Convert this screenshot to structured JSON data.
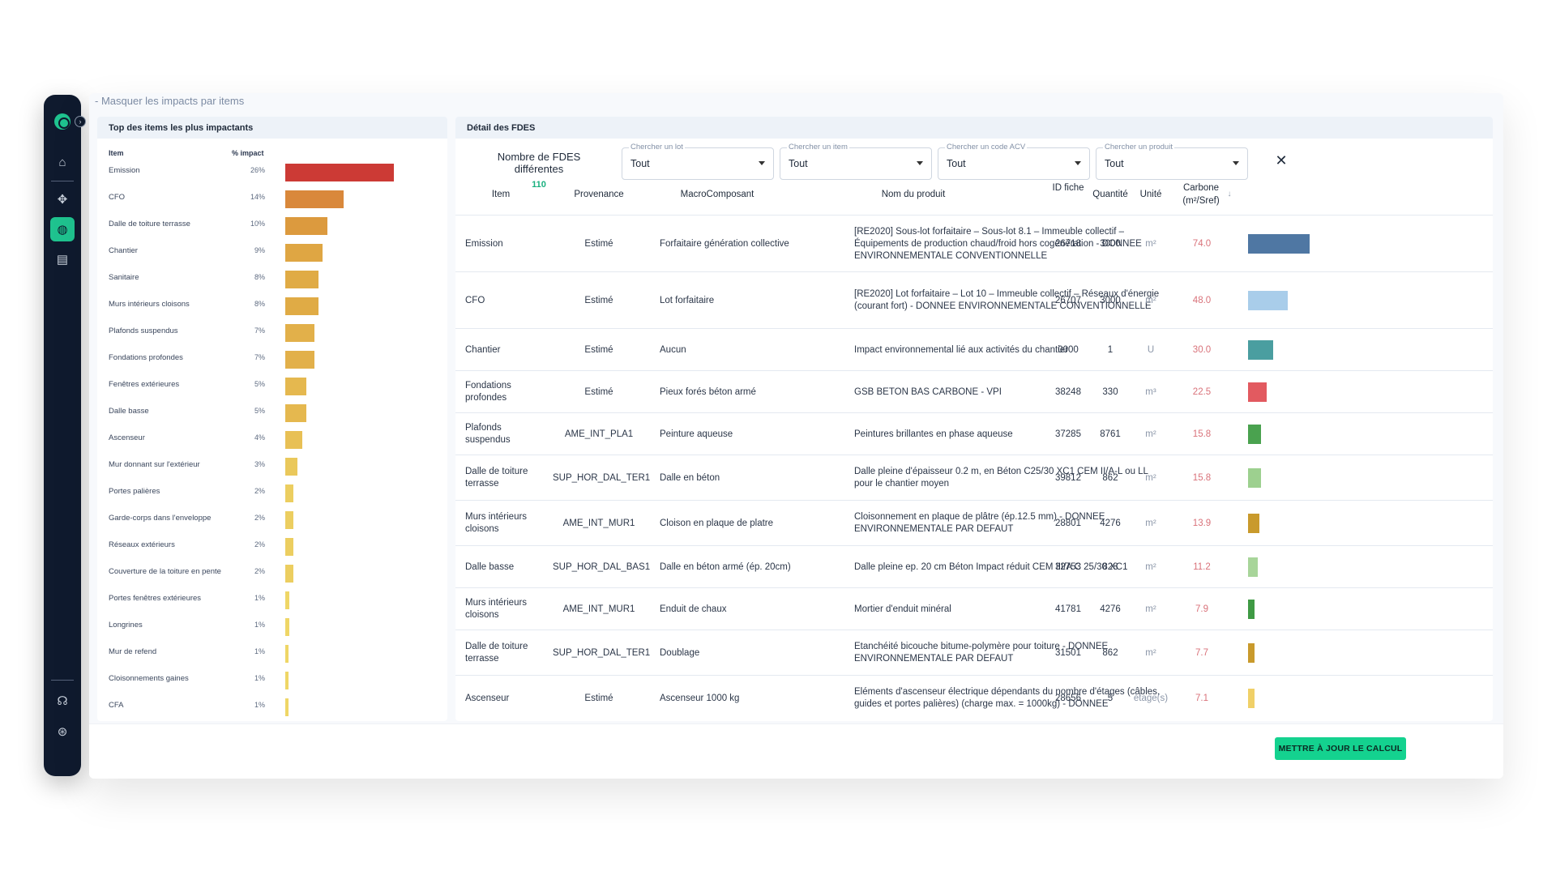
{
  "toggle_link": "- Masquer les impacts par items",
  "left_panel": {
    "title": "Top des items les plus impactants",
    "col_item": "Item",
    "col_pct": "% impact",
    "rows": [
      {
        "name": "Emission",
        "pct": "26%",
        "value": 26,
        "color": "#cc3a35"
      },
      {
        "name": "CFO",
        "pct": "14%",
        "value": 14,
        "color": "#d9883b"
      },
      {
        "name": "Dalle de toiture terrasse",
        "pct": "10%",
        "value": 10,
        "color": "#dc9a3e"
      },
      {
        "name": "Chantier",
        "pct": "9%",
        "value": 9,
        "color": "#dfa643"
      },
      {
        "name": "Sanitaire",
        "pct": "8%",
        "value": 8,
        "color": "#e0ab45"
      },
      {
        "name": "Murs intérieurs cloisons",
        "pct": "8%",
        "value": 8,
        "color": "#e0ab45"
      },
      {
        "name": "Plafonds suspendus",
        "pct": "7%",
        "value": 7,
        "color": "#e2b04a"
      },
      {
        "name": "Fondations profondes",
        "pct": "7%",
        "value": 7,
        "color": "#e2b04a"
      },
      {
        "name": "Fenêtres extérieures",
        "pct": "5%",
        "value": 5,
        "color": "#e5b84f"
      },
      {
        "name": "Dalle basse",
        "pct": "5%",
        "value": 5,
        "color": "#e5b84f"
      },
      {
        "name": "Ascenseur",
        "pct": "4%",
        "value": 4,
        "color": "#e8c055"
      },
      {
        "name": "Mur donnant sur l'extérieur",
        "pct": "3%",
        "value": 3,
        "color": "#eac85b"
      },
      {
        "name": "Portes palières",
        "pct": "2%",
        "value": 2,
        "color": "#ecce60"
      },
      {
        "name": "Garde-corps dans l'enveloppe",
        "pct": "2%",
        "value": 2,
        "color": "#ecce60"
      },
      {
        "name": "Réseaux extérieurs",
        "pct": "2%",
        "value": 2,
        "color": "#ecce60"
      },
      {
        "name": "Couverture de la toiture en pente",
        "pct": "2%",
        "value": 2,
        "color": "#ecce60"
      },
      {
        "name": "Portes fenêtres extérieures",
        "pct": "1%",
        "value": 1,
        "color": "#efd666"
      },
      {
        "name": "Longrines",
        "pct": "1%",
        "value": 1,
        "color": "#efd666"
      },
      {
        "name": "Mur de refend",
        "pct": "1%",
        "value": 0.7,
        "color": "#efd666"
      },
      {
        "name": "Cloisonnements gaines",
        "pct": "1%",
        "value": 0.7,
        "color": "#efd666"
      },
      {
        "name": "CFA",
        "pct": "1%",
        "value": 0.7,
        "color": "#efd666"
      }
    ]
  },
  "right_panel": {
    "title": "Détail des FDES",
    "count_label": "Nombre de FDES différentes",
    "count_value": "110",
    "filters": [
      {
        "label": "Chercher un lot",
        "value": "Tout"
      },
      {
        "label": "Chercher un item",
        "value": "Tout"
      },
      {
        "label": "Chercher un code ACV",
        "value": "Tout"
      },
      {
        "label": "Chercher un produit",
        "value": "Tout"
      }
    ],
    "close_label": "✕",
    "headers": {
      "item": "Item",
      "provenance": "Provenance",
      "macro": "MacroComposant",
      "nom": "Nom du produit",
      "id": "ID fiche",
      "qte": "Quantité",
      "unite": "Unité",
      "carbone": "Carbone (m²/Sref)",
      "sort": "↓"
    },
    "rows": [
      {
        "item": "Emission",
        "prov": "Estimé",
        "macro": "Forfaitaire génération collective",
        "nom": "[RE2020] Sous-lot forfaitaire – Sous-lot 8.1 – Immeuble collectif – Équipements de production chaud/froid hors cogénération - DONNEE ENVIRONNEMENTALE CONVENTIONNELLE",
        "id": "26718",
        "qte": "3000",
        "unite": "m²",
        "carbone": "74.0",
        "value": 74.0,
        "color": "#4f77a3"
      },
      {
        "item": "CFO",
        "prov": "Estimé",
        "macro": "Lot forfaitaire",
        "nom": "[RE2020] Lot forfaitaire – Lot 10 – Immeuble collectif – Réseaux d'énergie (courant fort) - DONNEE ENVIRONNEMENTALE CONVENTIONNELLE",
        "id": "26707",
        "qte": "3000",
        "unite": "m²",
        "carbone": "48.0",
        "value": 48.0,
        "color": "#a9cdea"
      },
      {
        "item": "Chantier",
        "prov": "Estimé",
        "macro": "Aucun",
        "nom": "Impact environnemental lié aux activités du chantier",
        "id": "0000",
        "qte": "1",
        "unite": "U",
        "carbone": "30.0",
        "value": 30.0,
        "color": "#4a9ea0"
      },
      {
        "item": "Fondations profondes",
        "prov": "Estimé",
        "macro": "Pieux forés béton armé",
        "nom": "GSB BETON BAS CARBONE - VPI",
        "id": "38248",
        "qte": "330",
        "unite": "m³",
        "carbone": "22.5",
        "value": 22.5,
        "color": "#e25a60"
      },
      {
        "item": "Plafonds suspendus",
        "prov": "AME_INT_PLA1",
        "macro": "Peinture aqueuse",
        "nom": "Peintures brillantes en phase aqueuse",
        "id": "37285",
        "qte": "8761",
        "unite": "m²",
        "carbone": "15.8",
        "value": 15.8,
        "color": "#4aa24f"
      },
      {
        "item": "Dalle de toiture terrasse",
        "prov": "SUP_HOR_DAL_TER1",
        "macro": "Dalle en béton",
        "nom": "Dalle pleine d'épaisseur 0.2 m, en Béton C25/30 XC1 CEM II/A-L ou LL pour le chantier moyen",
        "id": "39812",
        "qte": "862",
        "unite": "m²",
        "carbone": "15.8",
        "value": 15.8,
        "color": "#9dd08f"
      },
      {
        "item": "Murs intérieurs cloisons",
        "prov": "AME_INT_MUR1",
        "macro": "Cloison en plaque de platre",
        "nom": "Cloisonnement en plaque de plâtre (ép.12.5 mm) - DONNEE ENVIRONNEMENTALE PAR DEFAUT",
        "id": "28801",
        "qte": "4276",
        "unite": "m²",
        "carbone": "13.9",
        "value": 13.9,
        "color": "#c99a2c"
      },
      {
        "item": "Dalle basse",
        "prov": "SUP_HOR_DAL_BAS1",
        "macro": "Dalle en béton armé (ép. 20cm)",
        "nom": "Dalle pleine ep. 20 cm Béton Impact réduit CEM III/A C 25/30 XC1",
        "id": "32753",
        "qte": "828",
        "unite": "m²",
        "carbone": "11.2",
        "value": 11.2,
        "color": "#a8d59a"
      },
      {
        "item": "Murs intérieurs cloisons",
        "prov": "AME_INT_MUR1",
        "macro": "Enduit de chaux",
        "nom": "Mortier d'enduit minéral",
        "id": "41781",
        "qte": "4276",
        "unite": "m²",
        "carbone": "7.9",
        "value": 7.9,
        "color": "#3f9a44"
      },
      {
        "item": "Dalle de toiture terrasse",
        "prov": "SUP_HOR_DAL_TER1",
        "macro": "Doublage",
        "nom": "Etanchéité bicouche bitume-polymère pour toiture - DONNEE ENVIRONNEMENTALE PAR DEFAUT",
        "id": "31501",
        "qte": "862",
        "unite": "m²",
        "carbone": "7.7",
        "value": 7.7,
        "color": "#c99a2c"
      },
      {
        "item": "Ascenseur",
        "prov": "Estimé",
        "macro": "Ascenseur 1000 kg",
        "nom": "Eléments d'ascenseur électrique dépendants du nombre d'étages (câbles, guides et portes palières) (charge max. = 1000kg) - DONNEE",
        "id": "28656",
        "qte": "5",
        "unite": "étage(s)",
        "carbone": "7.1",
        "value": 7.1,
        "color": "#f0d068"
      }
    ]
  },
  "update_button": "METTRE À JOUR LE CALCUL",
  "icons": {
    "logo": "logo-icon",
    "home": "home-icon",
    "puzzle": "puzzle-icon",
    "globe": "globe-icon",
    "document": "document-icon",
    "headset": "headset-icon",
    "support": "support-icon"
  }
}
